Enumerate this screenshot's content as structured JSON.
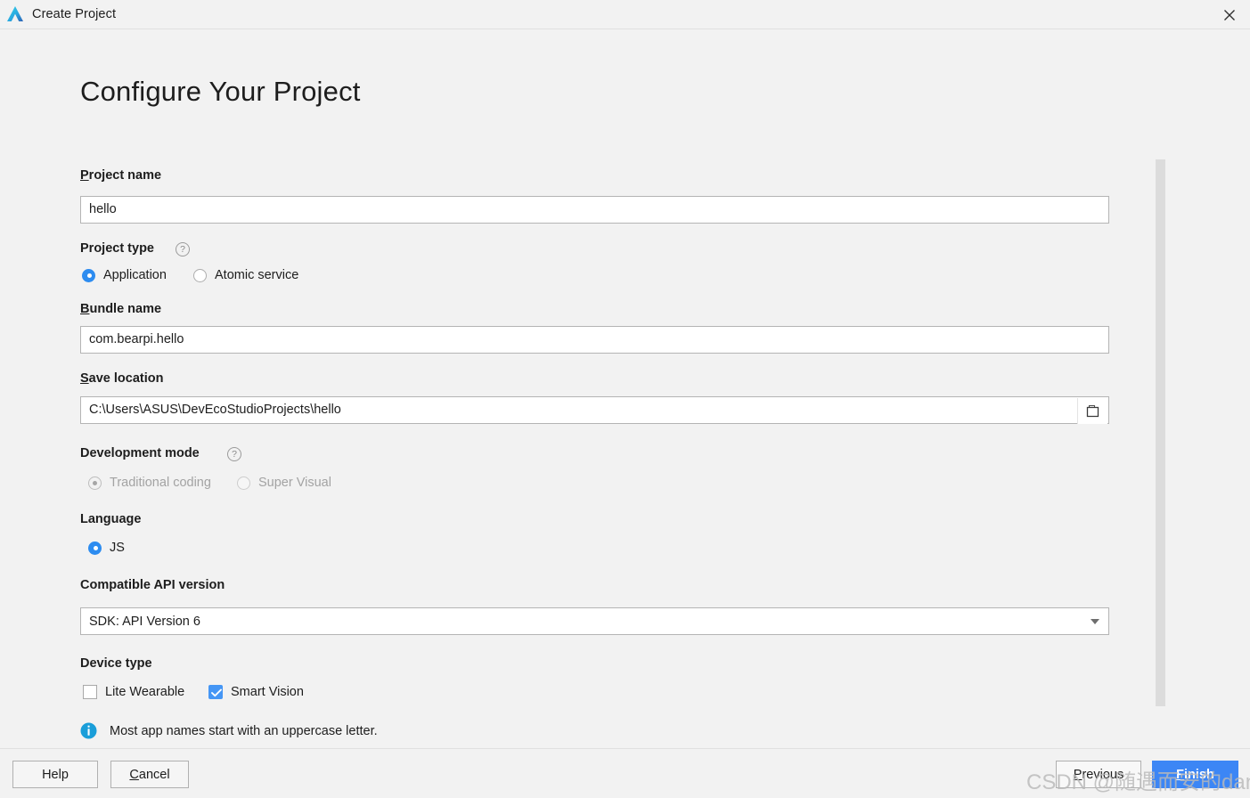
{
  "window": {
    "title": "Create Project",
    "logo_icon": "deveco-triangle-logo",
    "close_icon": "close-icon"
  },
  "page": {
    "title": "Configure Your Project"
  },
  "fields": {
    "project_name": {
      "label": "Project name",
      "mnemonic": "P",
      "label_rest": "roject name",
      "value": "hello"
    },
    "project_type": {
      "label": "Project type",
      "help_icon": "help-question-icon",
      "help_glyph": "?",
      "options": [
        {
          "label": "Application",
          "selected": true
        },
        {
          "label": "Atomic service",
          "selected": false
        }
      ]
    },
    "bundle_name": {
      "label": "Bundle name",
      "mnemonic": "B",
      "label_rest": "undle name",
      "value": "com.bearpi.hello"
    },
    "save_location": {
      "label": "Save location",
      "mnemonic": "S",
      "label_rest": "ave location",
      "value": "C:\\Users\\ASUS\\DevEcoStudioProjects\\hello",
      "browse_icon": "folder-open-icon"
    },
    "development_mode": {
      "label": "Development mode",
      "help_icon": "help-question-icon",
      "help_glyph": "?",
      "disabled": true,
      "options": [
        {
          "label": "Traditional coding",
          "selected": true
        },
        {
          "label": "Super Visual",
          "selected": false
        }
      ]
    },
    "language": {
      "label": "Language",
      "options": [
        {
          "label": "JS",
          "selected": true
        }
      ]
    },
    "compatible_api_version": {
      "label": "Compatible API version",
      "value": "SDK: API Version 6",
      "arrow_icon": "chevron-down-icon"
    },
    "device_type": {
      "label": "Device type",
      "options": [
        {
          "label": "Lite Wearable",
          "checked": false
        },
        {
          "label": "Smart Vision",
          "checked": true
        }
      ]
    }
  },
  "info": {
    "icon": "info-circle-icon",
    "message": "Most app names start with an uppercase letter."
  },
  "footer": {
    "help": {
      "label": "Help"
    },
    "cancel": {
      "mnemonic": "C",
      "label_rest": "ancel"
    },
    "previous": {
      "mnemonic": "P",
      "label_rest": "revious"
    },
    "finish": {
      "mnemonic": "F",
      "label_rest": "inish"
    }
  },
  "watermark": {
    "text": "CSDN @随遇而安的dandelion"
  },
  "colors": {
    "accent_blue": "#3c86f5",
    "radio_blue": "#2d8cf0",
    "checkbox_blue": "#4596f5",
    "info_blue": "#1a9ed9",
    "window_bg": "#f2f2f2",
    "input_bg": "#ffffff",
    "input_border": "#b4b4b4",
    "disabled_text": "#a3a3a3",
    "scrollbar_thumb": "#dcdcdc"
  }
}
